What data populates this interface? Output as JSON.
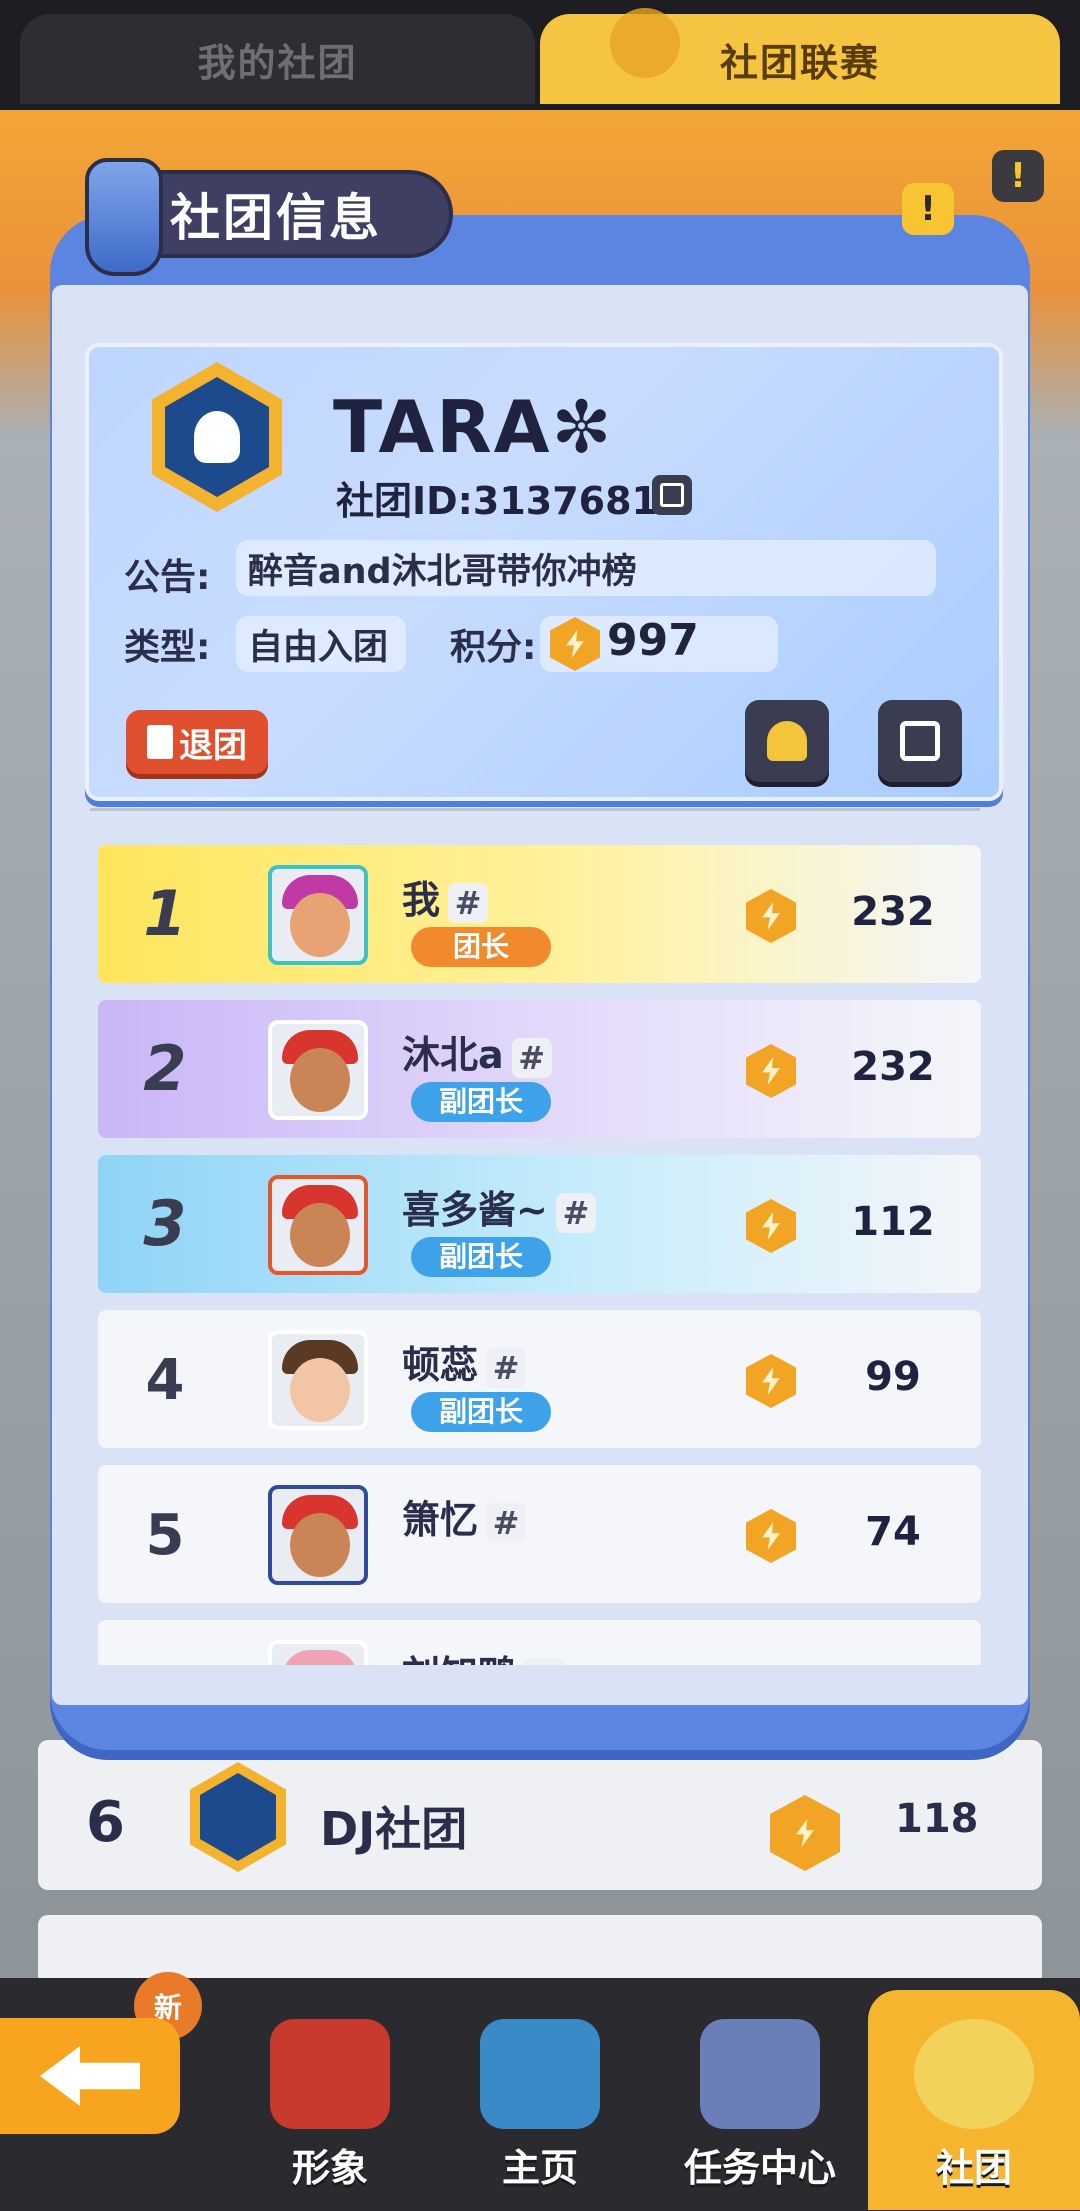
{
  "top_tabs": {
    "my_club": "我的社团",
    "league": "社团联赛"
  },
  "modal": {
    "title": "社团信息",
    "club": {
      "name": "TARA✼",
      "id_text": "社团ID:3137681",
      "notice_label": "公告:",
      "notice": "醉音and沐北哥带你冲榜",
      "type_label": "类型:",
      "type": "自由入团",
      "score_label": "积分:",
      "score": "997"
    },
    "quit_label": "退团",
    "members": [
      {
        "rank": "1",
        "name": "我",
        "role": "团长",
        "points": "232"
      },
      {
        "rank": "2",
        "name": "沐北a",
        "role": "副团长",
        "points": "232"
      },
      {
        "rank": "3",
        "name": "喜多酱~",
        "role": "副团长",
        "points": "112"
      },
      {
        "rank": "4",
        "name": "顿蕊",
        "role": "副团长",
        "points": "99"
      },
      {
        "rank": "5",
        "name": "箫忆",
        "role": "",
        "points": "74"
      },
      {
        "rank": "",
        "name": "刘知鸭",
        "role": "",
        "points": ""
      }
    ]
  },
  "background_list": {
    "row6": {
      "rank": "6",
      "name": "DJ社团",
      "points": "118"
    }
  },
  "bottom_nav": {
    "new_badge": "新",
    "items": [
      "形象",
      "主页",
      "任务中心",
      "社团"
    ]
  },
  "colors": {
    "modal_blue": "#5b85e0",
    "accent_yellow": "#f6b52e",
    "role_blue": "#3da2ea",
    "role_orange": "#f08a2c",
    "quit_red": "#e0502e"
  },
  "icons": [
    "warning-icon",
    "copy-icon",
    "coin-icon",
    "bell-icon",
    "edit-icon",
    "exit-door-icon",
    "back-arrow-icon",
    "hash-icon"
  ]
}
